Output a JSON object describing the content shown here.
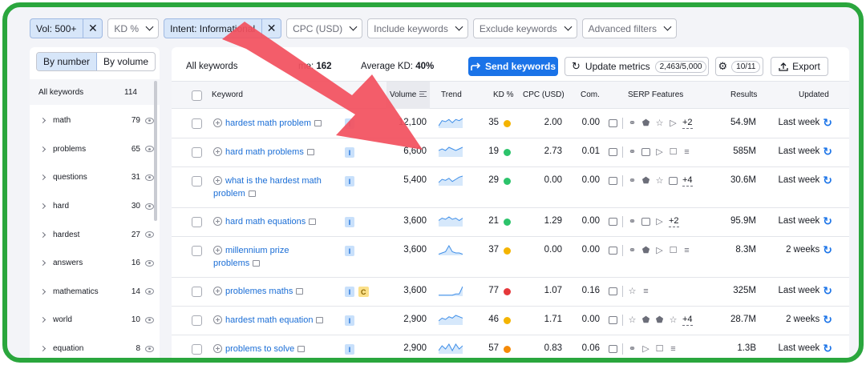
{
  "filters": [
    {
      "label": "Vol: 500+",
      "active": true,
      "removable": true
    },
    {
      "label": "KD %",
      "active": false,
      "dropdown": true
    },
    {
      "label": "Intent: Informational",
      "active": true,
      "removable": true
    },
    {
      "label": "CPC (USD)",
      "active": false,
      "dropdown": true
    },
    {
      "label": "Include keywords",
      "active": false,
      "dropdown": true
    },
    {
      "label": "Exclude keywords",
      "active": false,
      "dropdown": true
    },
    {
      "label": "Advanced filters",
      "active": false,
      "dropdown": true
    }
  ],
  "sidebar": {
    "tab_number": "By number",
    "tab_volume": "By volume",
    "all_label": "All keywords",
    "all_count": "114",
    "items": [
      {
        "name": "math",
        "count": "79"
      },
      {
        "name": "problems",
        "count": "65"
      },
      {
        "name": "questions",
        "count": "31"
      },
      {
        "name": "hard",
        "count": "30"
      },
      {
        "name": "hardest",
        "count": "27"
      },
      {
        "name": "answers",
        "count": "16"
      },
      {
        "name": "mathematics",
        "count": "14"
      },
      {
        "name": "world",
        "count": "10"
      },
      {
        "name": "equation",
        "count": "8"
      }
    ]
  },
  "toolbar": {
    "summary_prefix": "All keywords",
    "summary_visible_tail": "me:",
    "summary_visible_count": "162",
    "avg_label": "Average KD:",
    "avg_value": "40%",
    "send_label": "Send keywords",
    "update_label": "Update metrics",
    "update_quota": "2,463/5,000",
    "settings_count": "10/11",
    "export_label": "Export"
  },
  "columns": {
    "keyword": "Keyword",
    "volume": "Volume",
    "trend": "Trend",
    "kd": "KD %",
    "cpc": "CPC (USD)",
    "com": "Com.",
    "serp": "SERP Features",
    "results": "Results",
    "updated": "Updated"
  },
  "rows": [
    {
      "keyword": [
        "hardest math problem"
      ],
      "intent": [
        "I"
      ],
      "volume": "12,100",
      "trend": [
        2,
        7,
        6,
        8,
        5,
        8,
        7,
        9
      ],
      "kd": "35",
      "kd_color": "#f4b400",
      "cpc": "2.00",
      "com": "0.00",
      "serp_icons": [
        "snippet-icon",
        "link-icon",
        "knowledge-icon",
        "star-icon",
        "video-icon"
      ],
      "serp_more": "+2",
      "results": "54.9M",
      "updated": "Last week"
    },
    {
      "keyword": [
        "hard math problems"
      ],
      "intent": [
        "I"
      ],
      "volume": "6,600",
      "trend": [
        4,
        5,
        4,
        6,
        5,
        4,
        5,
        6
      ],
      "kd": "19",
      "kd_color": "#2cc36b",
      "cpc": "2.73",
      "com": "0.01",
      "serp_icons": [
        "snippet-icon",
        "link-icon",
        "image-icon",
        "video-icon",
        "qa-icon",
        "list-icon"
      ],
      "serp_more": "",
      "results": "585M",
      "updated": "Last week"
    },
    {
      "keyword": [
        "what is the hardest math",
        "problem"
      ],
      "intent": [
        "I"
      ],
      "volume": "5,400",
      "trend": [
        3,
        6,
        5,
        7,
        4,
        6,
        8,
        9
      ],
      "kd": "29",
      "kd_color": "#2cc36b",
      "cpc": "0.00",
      "com": "0.00",
      "serp_icons": [
        "snippet-icon",
        "link-icon",
        "knowledge-icon",
        "star-icon",
        "image-icon"
      ],
      "serp_more": "+4",
      "results": "30.6M",
      "updated": "Last week"
    },
    {
      "keyword": [
        "hard math equations"
      ],
      "intent": [
        "I"
      ],
      "volume": "3,600",
      "trend": [
        5,
        7,
        6,
        8,
        6,
        7,
        5,
        7
      ],
      "kd": "21",
      "kd_color": "#2cc36b",
      "cpc": "1.29",
      "com": "0.00",
      "serp_icons": [
        "snippet-icon",
        "link-icon",
        "image-icon",
        "video-icon"
      ],
      "serp_more": "+2",
      "results": "95.9M",
      "updated": "Last week"
    },
    {
      "keyword": [
        "millennium prize",
        "problems"
      ],
      "intent": [
        "I"
      ],
      "volume": "3,600",
      "trend": [
        1,
        2,
        3,
        8,
        3,
        2,
        2,
        1
      ],
      "kd": "37",
      "kd_color": "#f4b400",
      "cpc": "0.00",
      "com": "0.00",
      "serp_icons": [
        "snippet-icon",
        "link-icon",
        "knowledge-icon",
        "video-icon",
        "qa-icon",
        "list-icon"
      ],
      "serp_more": "",
      "results": "8.3M",
      "updated": "2 weeks"
    },
    {
      "keyword": [
        "problemes maths"
      ],
      "intent": [
        "I",
        "C"
      ],
      "volume": "3,600",
      "trend": [
        1,
        1,
        1,
        1,
        1,
        2,
        2,
        9
      ],
      "kd": "77",
      "kd_color": "#e5383b",
      "cpc": "1.07",
      "com": "0.16",
      "serp_icons": [
        "snippet-icon",
        "star-icon",
        "list-icon"
      ],
      "serp_more": "",
      "results": "325M",
      "updated": "Last week"
    },
    {
      "keyword": [
        "hardest math equation"
      ],
      "intent": [
        "I"
      ],
      "volume": "2,900",
      "trend": [
        3,
        5,
        4,
        6,
        5,
        7,
        6,
        5
      ],
      "kd": "46",
      "kd_color": "#f4b400",
      "cpc": "1.71",
      "com": "0.00",
      "serp_icons": [
        "snippet-icon",
        "star-icon",
        "knowledge-icon",
        "knowledge-icon",
        "star-icon"
      ],
      "serp_more": "+4",
      "results": "28.7M",
      "updated": "2 weeks"
    },
    {
      "keyword": [
        "problems to solve"
      ],
      "intent": [
        "I"
      ],
      "volume": "2,900",
      "trend": [
        2,
        5,
        3,
        6,
        2,
        6,
        3,
        5
      ],
      "kd": "57",
      "kd_color": "#f58a07",
      "cpc": "0.83",
      "com": "0.06",
      "serp_icons": [
        "snippet-icon",
        "link-icon",
        "video-icon",
        "qa-icon",
        "list-icon"
      ],
      "serp_more": "",
      "results": "1.3B",
      "updated": "Last week"
    }
  ],
  "colors": {
    "accent": "#1a73e8",
    "frame": "#2aa63d",
    "arrow": "#f2515f",
    "link": "#1b6ed6"
  }
}
